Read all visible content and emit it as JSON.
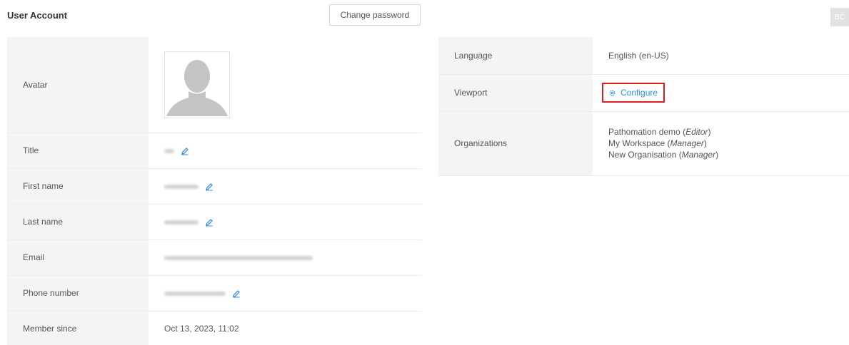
{
  "header": {
    "title": "User Account",
    "change_password_label": "Change password",
    "user_initials": "BC"
  },
  "account": {
    "avatar_label": "Avatar",
    "title_label": "Title",
    "first_name_label": "First name",
    "last_name_label": "Last name",
    "email_label": "Email",
    "phone_label": "Phone number",
    "member_since_label": "Member since",
    "member_since_value": "Oct 13, 2023, 11:02"
  },
  "settings": {
    "language_label": "Language",
    "language_value": "English (en-US)",
    "viewport_label": "Viewport",
    "configure_label": "Configure",
    "organizations_label": "Organizations",
    "organizations": [
      {
        "name": "Pathomation demo",
        "role": "Editor"
      },
      {
        "name": "My Workspace",
        "role": "Manager"
      },
      {
        "name": "New Organisation",
        "role": "Manager"
      }
    ]
  },
  "colors": {
    "accent": "#2f8ee6",
    "highlight": "#e01b1b",
    "label_bg": "#f4f4f4"
  },
  "icons": {
    "edit": "pencil-icon",
    "configure": "gear-icon",
    "avatar": "person-silhouette-icon"
  }
}
